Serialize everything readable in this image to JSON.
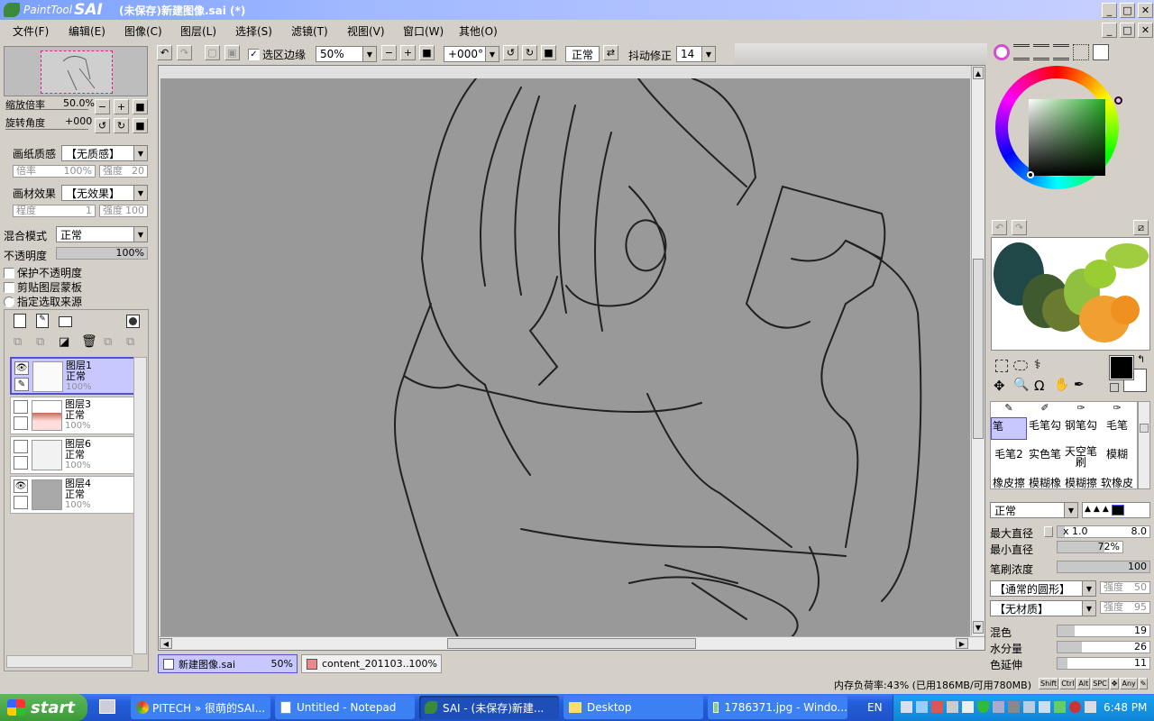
{
  "window": {
    "title": "(未保存)新建图像.sai (*)",
    "logo_paint": "PaintTool",
    "logo_sai": "SAI"
  },
  "menu": [
    "文件(F)",
    "编辑(E)",
    "图像(C)",
    "图层(L)",
    "选择(S)",
    "滤镜(T)",
    "视图(V)",
    "窗口(W)",
    "其他(O)"
  ],
  "toolbar": {
    "selection_edge": "选区边缘",
    "zoom": "50%",
    "angle": "+000°",
    "blend": "正常",
    "stabilizer_label": "抖动修正",
    "stabilizer": "14"
  },
  "nav": {
    "zoom_label": "缩放倍率",
    "zoom_value": "50.0%",
    "angle_label": "旋转角度",
    "angle_value": "+000"
  },
  "paper": {
    "texture_label": "画纸质感",
    "texture_value": "【无质感】",
    "scale_label": "倍率",
    "scale_value": "100%",
    "strength_label": "强度",
    "strength_value": "20",
    "effect_label": "画材效果",
    "effect_value": "【无效果】",
    "degree_label": "程度",
    "degree_value": "1",
    "effect_strength_label": "强度",
    "effect_strength_value": "100"
  },
  "layer_props": {
    "blend_label": "混合模式",
    "blend_value": "正常",
    "opacity_label": "不透明度",
    "opacity_value": "100%",
    "protect": "保护不透明度",
    "clip": "剪贴图层蒙板",
    "source": "指定选取来源"
  },
  "layers": [
    {
      "name": "图层1",
      "mode": "正常",
      "opacity": "100%",
      "visible": true,
      "selected": true
    },
    {
      "name": "图层3",
      "mode": "正常",
      "opacity": "100%",
      "visible": false,
      "selected": false
    },
    {
      "name": "图层6",
      "mode": "正常",
      "opacity": "100%",
      "visible": false,
      "selected": false
    },
    {
      "name": "图层4",
      "mode": "正常",
      "opacity": "100%",
      "visible": true,
      "selected": false
    }
  ],
  "doc_tabs": [
    {
      "name": "新建图像.sai",
      "zoom": "50%"
    },
    {
      "name": "content_201103...",
      "zoom": "100%"
    }
  ],
  "brushes": {
    "row1": [
      "笔",
      "毛笔勾",
      "钢笔勾",
      "毛笔"
    ],
    "row2": [
      "毛笔2",
      "实色笔",
      "天空笔刷",
      "模糊"
    ],
    "row3": [
      "橡皮擦",
      "模糊橡",
      "模糊擦",
      "软橡皮"
    ]
  },
  "brush_settings": {
    "mode": "正常",
    "max_label": "最大直径",
    "max_mult": "x 1.0",
    "max_value": "8.0",
    "min_label": "最小直径",
    "min_value": "72%",
    "density_label": "笔刷浓度",
    "density_value": "100",
    "shape": "【通常的圆形】",
    "shape_strength_label": "强度",
    "shape_strength": "50",
    "texture": "【无材质】",
    "texture_strength_label": "强度",
    "texture_strength": "95",
    "mix_label": "混色",
    "mix_value": "19",
    "water_label": "水分量",
    "water_value": "26",
    "extend_label": "色延伸",
    "extend_value": "11"
  },
  "status": {
    "memory": "内存负荷率:43% (已用186MB/可用780MB)",
    "keys": [
      "Shift",
      "Ctrl",
      "Alt",
      "SPC"
    ],
    "any": "Any"
  },
  "taskbar": {
    "start": "start",
    "items": [
      "PITECH » 很萌的SAI...",
      "Untitled - Notepad",
      "SAI - (未保存)新建...",
      "Desktop",
      "1786371.jpg - Windo..."
    ],
    "lang": "EN",
    "clock": "6:48 PM"
  },
  "colors": {
    "titlebar": "#2a54d6",
    "taskbar": "#245edb",
    "start": "#3c9b35",
    "selected_layer": "#c8c8ff",
    "canvas": "#999999"
  }
}
